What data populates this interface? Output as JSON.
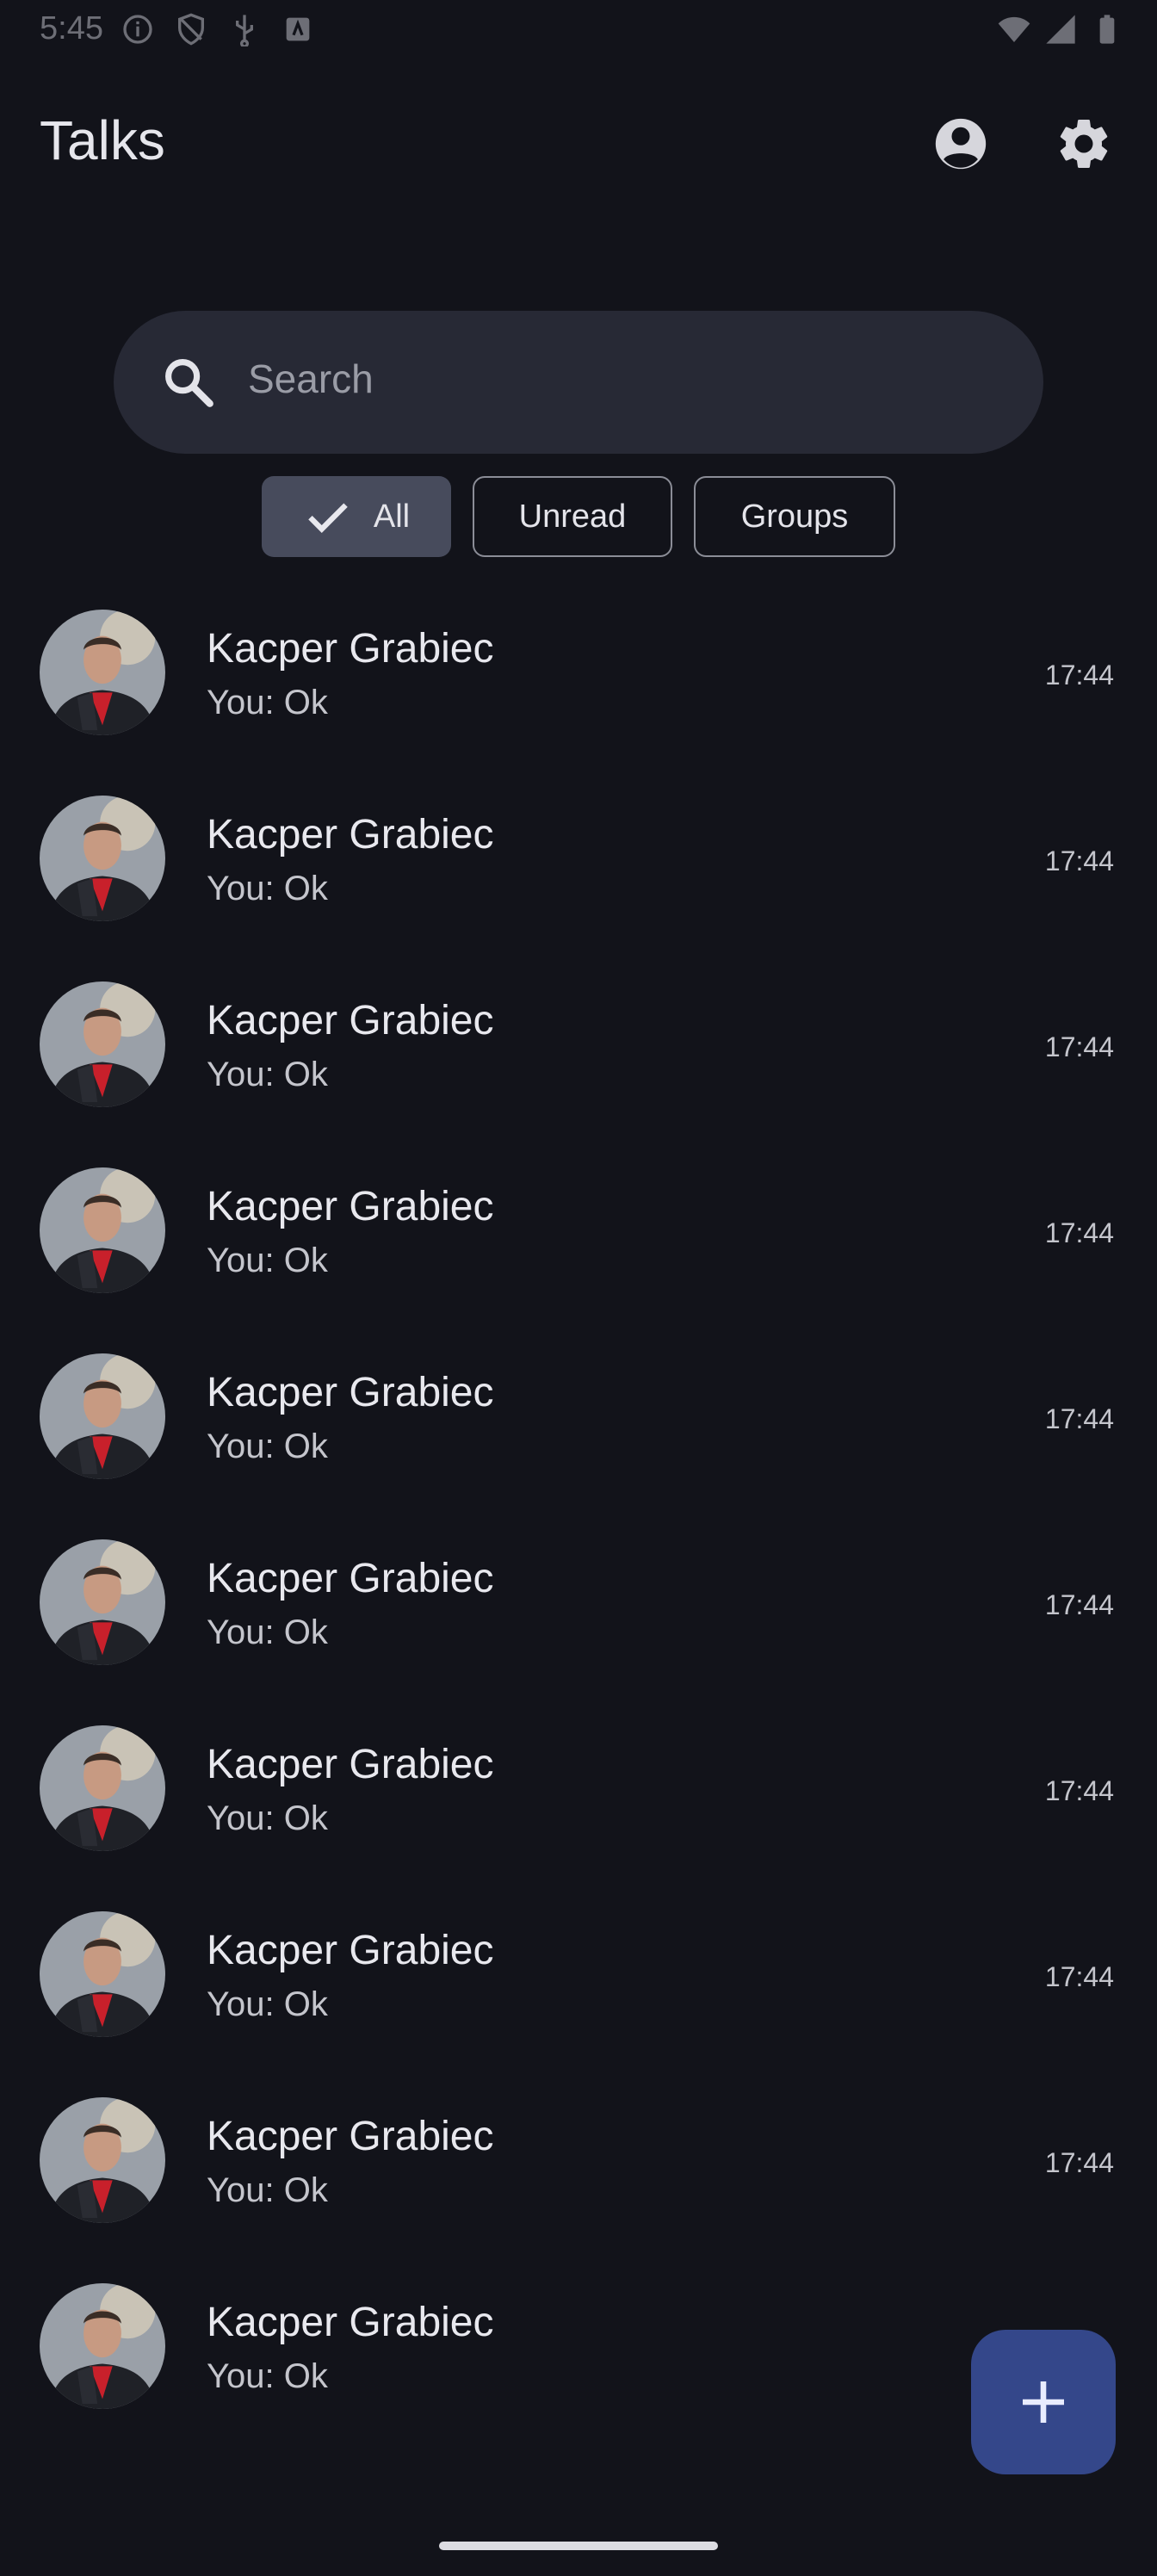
{
  "status_bar": {
    "time": "5:45"
  },
  "app_bar": {
    "title": "Talks",
    "account_icon": "account-circle-icon",
    "settings_icon": "gear-icon"
  },
  "search": {
    "placeholder": "Search"
  },
  "filters": {
    "all": "All",
    "unread": "Unread",
    "groups": "Groups",
    "selected": "All"
  },
  "conversations": [
    {
      "name": "Kacper Grabiec",
      "preview": "You: Ok",
      "time": "17:44"
    },
    {
      "name": "Kacper Grabiec",
      "preview": "You: Ok",
      "time": "17:44"
    },
    {
      "name": "Kacper Grabiec",
      "preview": "You: Ok",
      "time": "17:44"
    },
    {
      "name": "Kacper Grabiec",
      "preview": "You: Ok",
      "time": "17:44"
    },
    {
      "name": "Kacper Grabiec",
      "preview": "You: Ok",
      "time": "17:44"
    },
    {
      "name": "Kacper Grabiec",
      "preview": "You: Ok",
      "time": "17:44"
    },
    {
      "name": "Kacper Grabiec",
      "preview": "You: Ok",
      "time": "17:44"
    },
    {
      "name": "Kacper Grabiec",
      "preview": "You: Ok",
      "time": "17:44"
    },
    {
      "name": "Kacper Grabiec",
      "preview": "You: Ok",
      "time": "17:44"
    },
    {
      "name": "Kacper Grabiec",
      "preview": "You: Ok",
      "time": ""
    }
  ],
  "fab": {
    "icon": "plus-icon"
  },
  "colors": {
    "background": "#12131a",
    "surface": "#272935",
    "chip_selected": "#474b5c",
    "fab": "#34478a"
  }
}
